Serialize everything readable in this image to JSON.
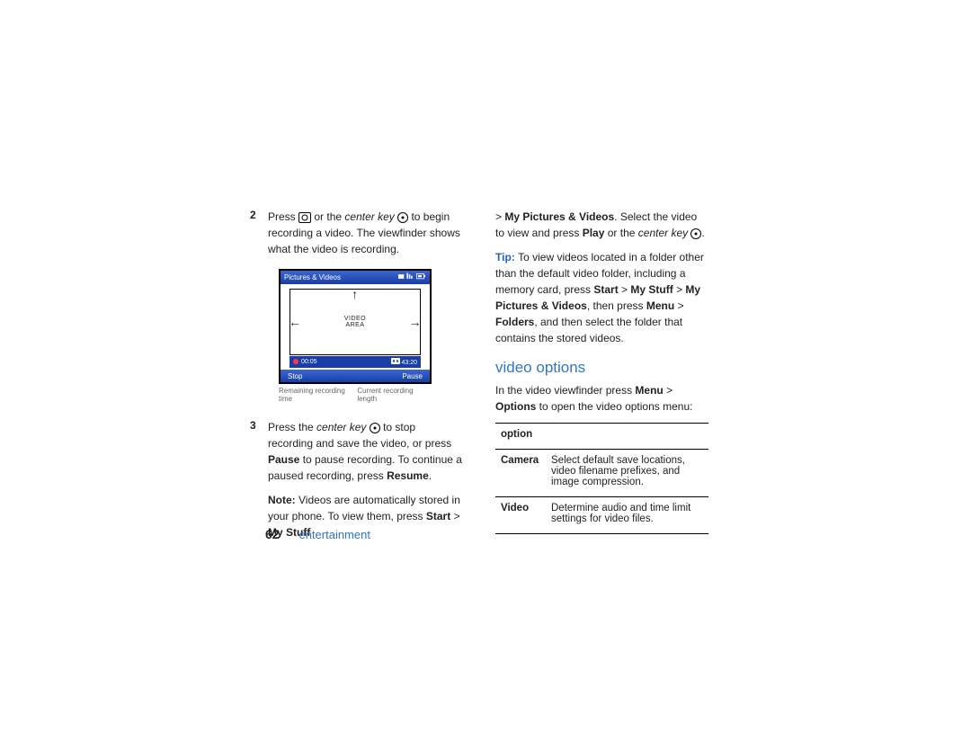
{
  "col1": {
    "step2": {
      "num": "2",
      "text_a": "Press ",
      "text_b": " or the ",
      "center_key": "center key",
      "text_c": " to begin recording a video. The viewfinder shows what the video is recording."
    },
    "viewfinder": {
      "title": "Pictures & Videos",
      "center_label_1": "VIDEO",
      "center_label_2": "AREA",
      "elapsed": "00:05",
      "remaining": "43:20",
      "soft_left": "Stop",
      "soft_right": "Pause",
      "caption_left": "Remaining recording time",
      "caption_right": "Current recording length"
    },
    "step3": {
      "num": "3",
      "text_a": "Press the ",
      "center_key": "center key",
      "text_b": " to stop recording and save the video, or press ",
      "pause": "Pause",
      "text_c": " to pause recording. To continue a paused recording, press ",
      "resume": "Resume",
      "text_d": "."
    },
    "note": {
      "label": "Note: ",
      "text_a": "Videos are automatically stored in your phone. To view them, press ",
      "path1": "Start",
      "gt1": " > ",
      "path2": "My Stuff"
    }
  },
  "col2": {
    "cont": {
      "gt1": "> ",
      "path1": "My Pictures & Videos",
      "text_a": ". Select the video to view and press ",
      "play": "Play",
      "text_b": " or the ",
      "center_key": "center key",
      "text_c": "."
    },
    "tip": {
      "label": "Tip: ",
      "text_a": "To view videos located in a folder other than the default video folder, including a memory card, press ",
      "p1": "Start",
      "gt1": " > ",
      "p2": "My Stuff",
      "gt2": " > ",
      "p3": "My Pictures & Videos",
      "text_b": ", then press ",
      "p4": "Menu",
      "gt3": " > ",
      "p5": "Folders",
      "text_c": ", and then select the folder that contains the stored videos."
    },
    "heading": "video options",
    "intro": {
      "text_a": "In the video viewfinder press ",
      "m1": "Menu",
      "gt": " > ",
      "m2": "Options",
      "text_b": " to open the video options menu:"
    },
    "table": {
      "header": "option",
      "rows": [
        {
          "name": "Camera",
          "desc": "Select default save locations, video filename prefixes, and image compression."
        },
        {
          "name": "Video",
          "desc": "Determine audio and time limit settings for video files."
        }
      ]
    }
  },
  "footer": {
    "page": "62",
    "section": "entertainment"
  }
}
